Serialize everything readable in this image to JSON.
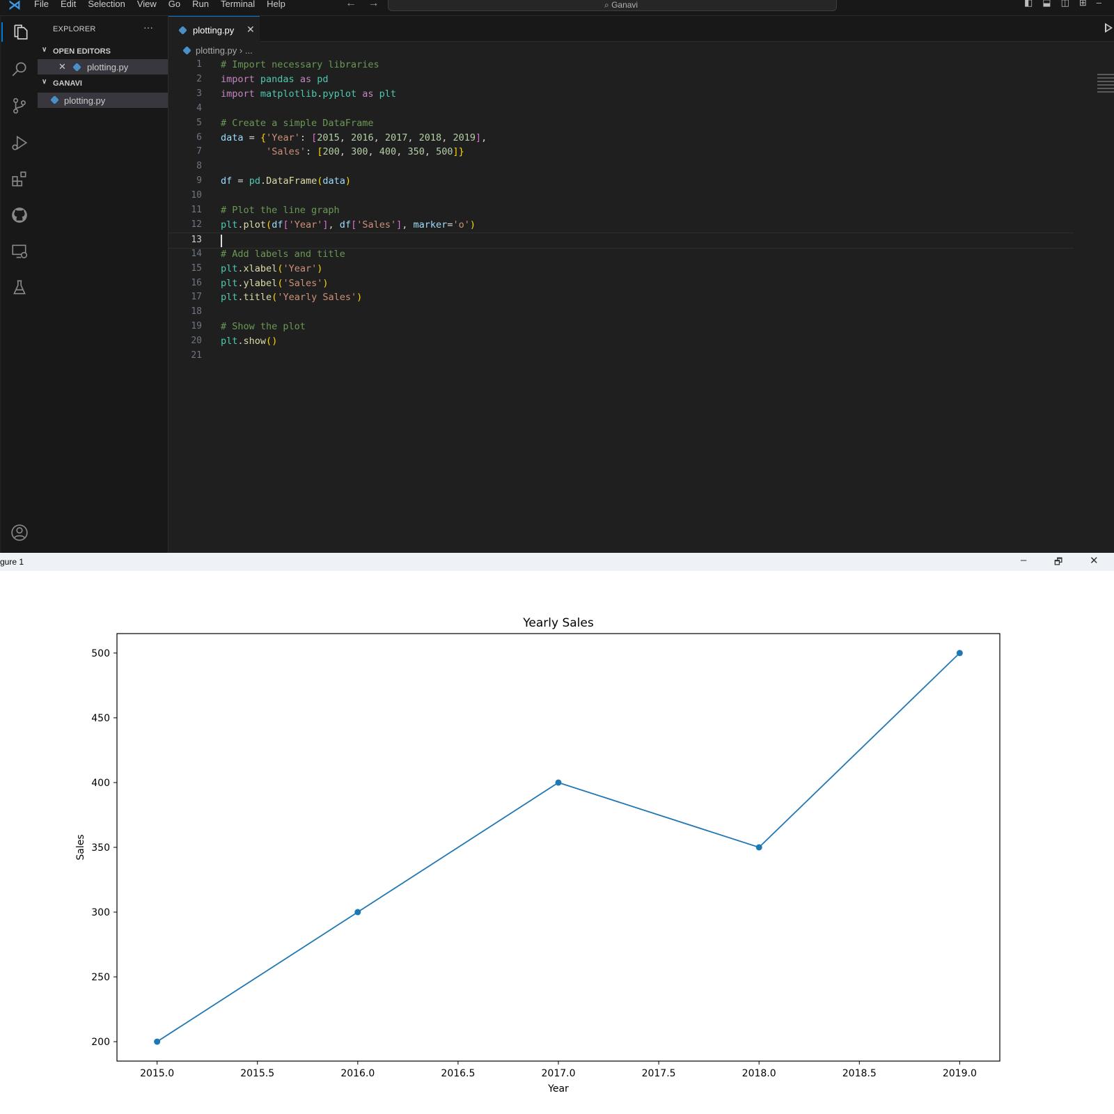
{
  "vscode": {
    "menu": [
      "File",
      "Edit",
      "Selection",
      "View",
      "Go",
      "Run",
      "Terminal",
      "Help"
    ],
    "command_center": "Ganavi",
    "explorer_title": "EXPLORER",
    "explorer_more": "···",
    "sections": {
      "open_editors": "OPEN EDITORS",
      "workspace": "GANAVI"
    },
    "open_editor_file": "plotting.py",
    "workspace_file": "plotting.py",
    "tab_label": "plotting.py",
    "breadcrumb": "plotting.py",
    "breadcrumb_tail": "...",
    "activity_icons": [
      "explorer-icon",
      "search-icon",
      "source-control-icon",
      "run-debug-icon",
      "extensions-icon",
      "github-icon",
      "remote-explorer-icon",
      "testing-icon",
      "account-icon"
    ],
    "current_line": 13,
    "code_lines": [
      "# Import necessary libraries",
      "import pandas as pd",
      "import matplotlib.pyplot as plt",
      "",
      "# Create a simple DataFrame",
      "data = {'Year': [2015, 2016, 2017, 2018, 2019],",
      "        'Sales': [200, 300, 400, 350, 500]}",
      "",
      "df = pd.DataFrame(data)",
      "",
      "# Plot the line graph",
      "plt.plot(df['Year'], df['Sales'], marker='o')",
      "",
      "# Add labels and title",
      "plt.xlabel('Year')",
      "plt.ylabel('Sales')",
      "plt.title('Yearly Sales')",
      "",
      "# Show the plot",
      "plt.show()",
      ""
    ]
  },
  "figure": {
    "window_title": "gure 1",
    "controls": [
      "–",
      "🗗",
      "✕"
    ]
  },
  "chart_data": {
    "type": "line",
    "title": "Yearly Sales",
    "xlabel": "Year",
    "ylabel": "Sales",
    "x": [
      2015,
      2016,
      2017,
      2018,
      2019
    ],
    "series": [
      {
        "values": [
          200,
          300,
          400,
          350,
          500
        ],
        "color": "#1f77b4",
        "marker": "o"
      }
    ],
    "xticks": [
      "2015.0",
      "2015.5",
      "2016.0",
      "2016.5",
      "2017.0",
      "2017.5",
      "2018.0",
      "2018.5",
      "2019.0"
    ],
    "yticks": [
      "200",
      "250",
      "300",
      "350",
      "400",
      "450",
      "500"
    ],
    "xlim": [
      2014.8,
      2019.2
    ],
    "ylim": [
      185,
      515
    ],
    "grid": false
  }
}
